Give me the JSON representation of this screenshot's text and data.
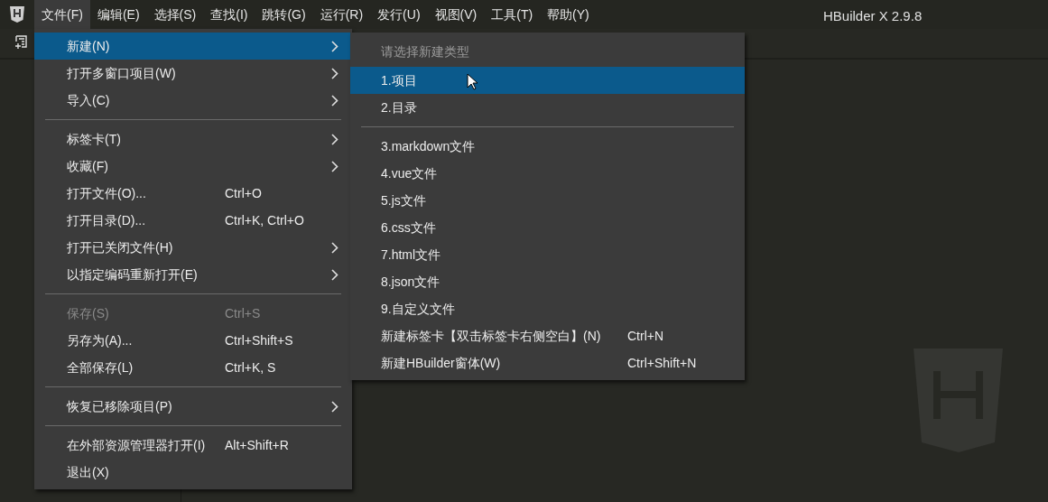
{
  "menubar": {
    "menus": [
      {
        "label": "文件(F)",
        "selected": true
      },
      {
        "label": "编辑(E)",
        "selected": false
      },
      {
        "label": "选择(S)",
        "selected": false
      },
      {
        "label": "查找(I)",
        "selected": false
      },
      {
        "label": "跳转(G)",
        "selected": false
      },
      {
        "label": "运行(R)",
        "selected": false
      },
      {
        "label": "发行(U)",
        "selected": false
      },
      {
        "label": "视图(V)",
        "selected": false
      },
      {
        "label": "工具(T)",
        "selected": false
      },
      {
        "label": "帮助(Y)",
        "selected": false
      }
    ],
    "title": "HBuilder X 2.9.8"
  },
  "file_menu": {
    "items": [
      {
        "kind": "item",
        "label": "新建(N)",
        "submenu": true,
        "selected": true,
        "disabled": false
      },
      {
        "kind": "item",
        "label": "打开多窗口项目(W)",
        "submenu": true,
        "selected": false,
        "disabled": false
      },
      {
        "kind": "item",
        "label": "导入(C)",
        "submenu": true,
        "selected": false,
        "disabled": false
      },
      {
        "kind": "separator"
      },
      {
        "kind": "item",
        "label": "标签卡(T)",
        "submenu": true,
        "selected": false,
        "disabled": false
      },
      {
        "kind": "item",
        "label": "收藏(F)",
        "submenu": true,
        "selected": false,
        "disabled": false
      },
      {
        "kind": "item",
        "label": "打开文件(O)...",
        "shortcut": "Ctrl+O",
        "submenu": false,
        "selected": false,
        "disabled": false
      },
      {
        "kind": "item",
        "label": "打开目录(D)...",
        "shortcut": "Ctrl+K, Ctrl+O",
        "submenu": false,
        "selected": false,
        "disabled": false
      },
      {
        "kind": "item",
        "label": "打开已关闭文件(H)",
        "submenu": true,
        "selected": false,
        "disabled": false
      },
      {
        "kind": "item",
        "label": "以指定编码重新打开(E)",
        "submenu": true,
        "selected": false,
        "disabled": false
      },
      {
        "kind": "separator"
      },
      {
        "kind": "item",
        "label": "保存(S)",
        "shortcut": "Ctrl+S",
        "submenu": false,
        "selected": false,
        "disabled": true
      },
      {
        "kind": "item",
        "label": "另存为(A)...",
        "shortcut": "Ctrl+Shift+S",
        "submenu": false,
        "selected": false,
        "disabled": false
      },
      {
        "kind": "item",
        "label": "全部保存(L)",
        "shortcut": "Ctrl+K, S",
        "submenu": false,
        "selected": false,
        "disabled": false
      },
      {
        "kind": "separator"
      },
      {
        "kind": "item",
        "label": "恢复已移除项目(P)",
        "submenu": true,
        "selected": false,
        "disabled": false
      },
      {
        "kind": "separator"
      },
      {
        "kind": "item",
        "label": "在外部资源管理器打开(I)",
        "shortcut": "Alt+Shift+R",
        "submenu": false,
        "selected": false,
        "disabled": false
      },
      {
        "kind": "item",
        "label": "退出(X)",
        "submenu": false,
        "selected": false,
        "disabled": false
      }
    ]
  },
  "new_submenu": {
    "items": [
      {
        "kind": "header",
        "label": "请选择新建类型"
      },
      {
        "kind": "item",
        "label": "1.项目",
        "selected": true
      },
      {
        "kind": "item",
        "label": "2.目录",
        "selected": false
      },
      {
        "kind": "separator"
      },
      {
        "kind": "item",
        "label": "3.markdown文件",
        "selected": false
      },
      {
        "kind": "item",
        "label": "4.vue文件",
        "selected": false
      },
      {
        "kind": "item",
        "label": "5.js文件",
        "selected": false
      },
      {
        "kind": "item",
        "label": "6.css文件",
        "selected": false
      },
      {
        "kind": "item",
        "label": "7.html文件",
        "selected": false
      },
      {
        "kind": "item",
        "label": "8.json文件",
        "selected": false
      },
      {
        "kind": "item",
        "label": "9.自定义文件",
        "selected": false
      },
      {
        "kind": "item",
        "label": "新建标签卡【双击标签卡右侧空白】(N)",
        "shortcut": "Ctrl+N",
        "selected": false
      },
      {
        "kind": "item",
        "label": "新建HBuilder窗体(W)",
        "shortcut": "Ctrl+Shift+N",
        "selected": false
      }
    ]
  }
}
